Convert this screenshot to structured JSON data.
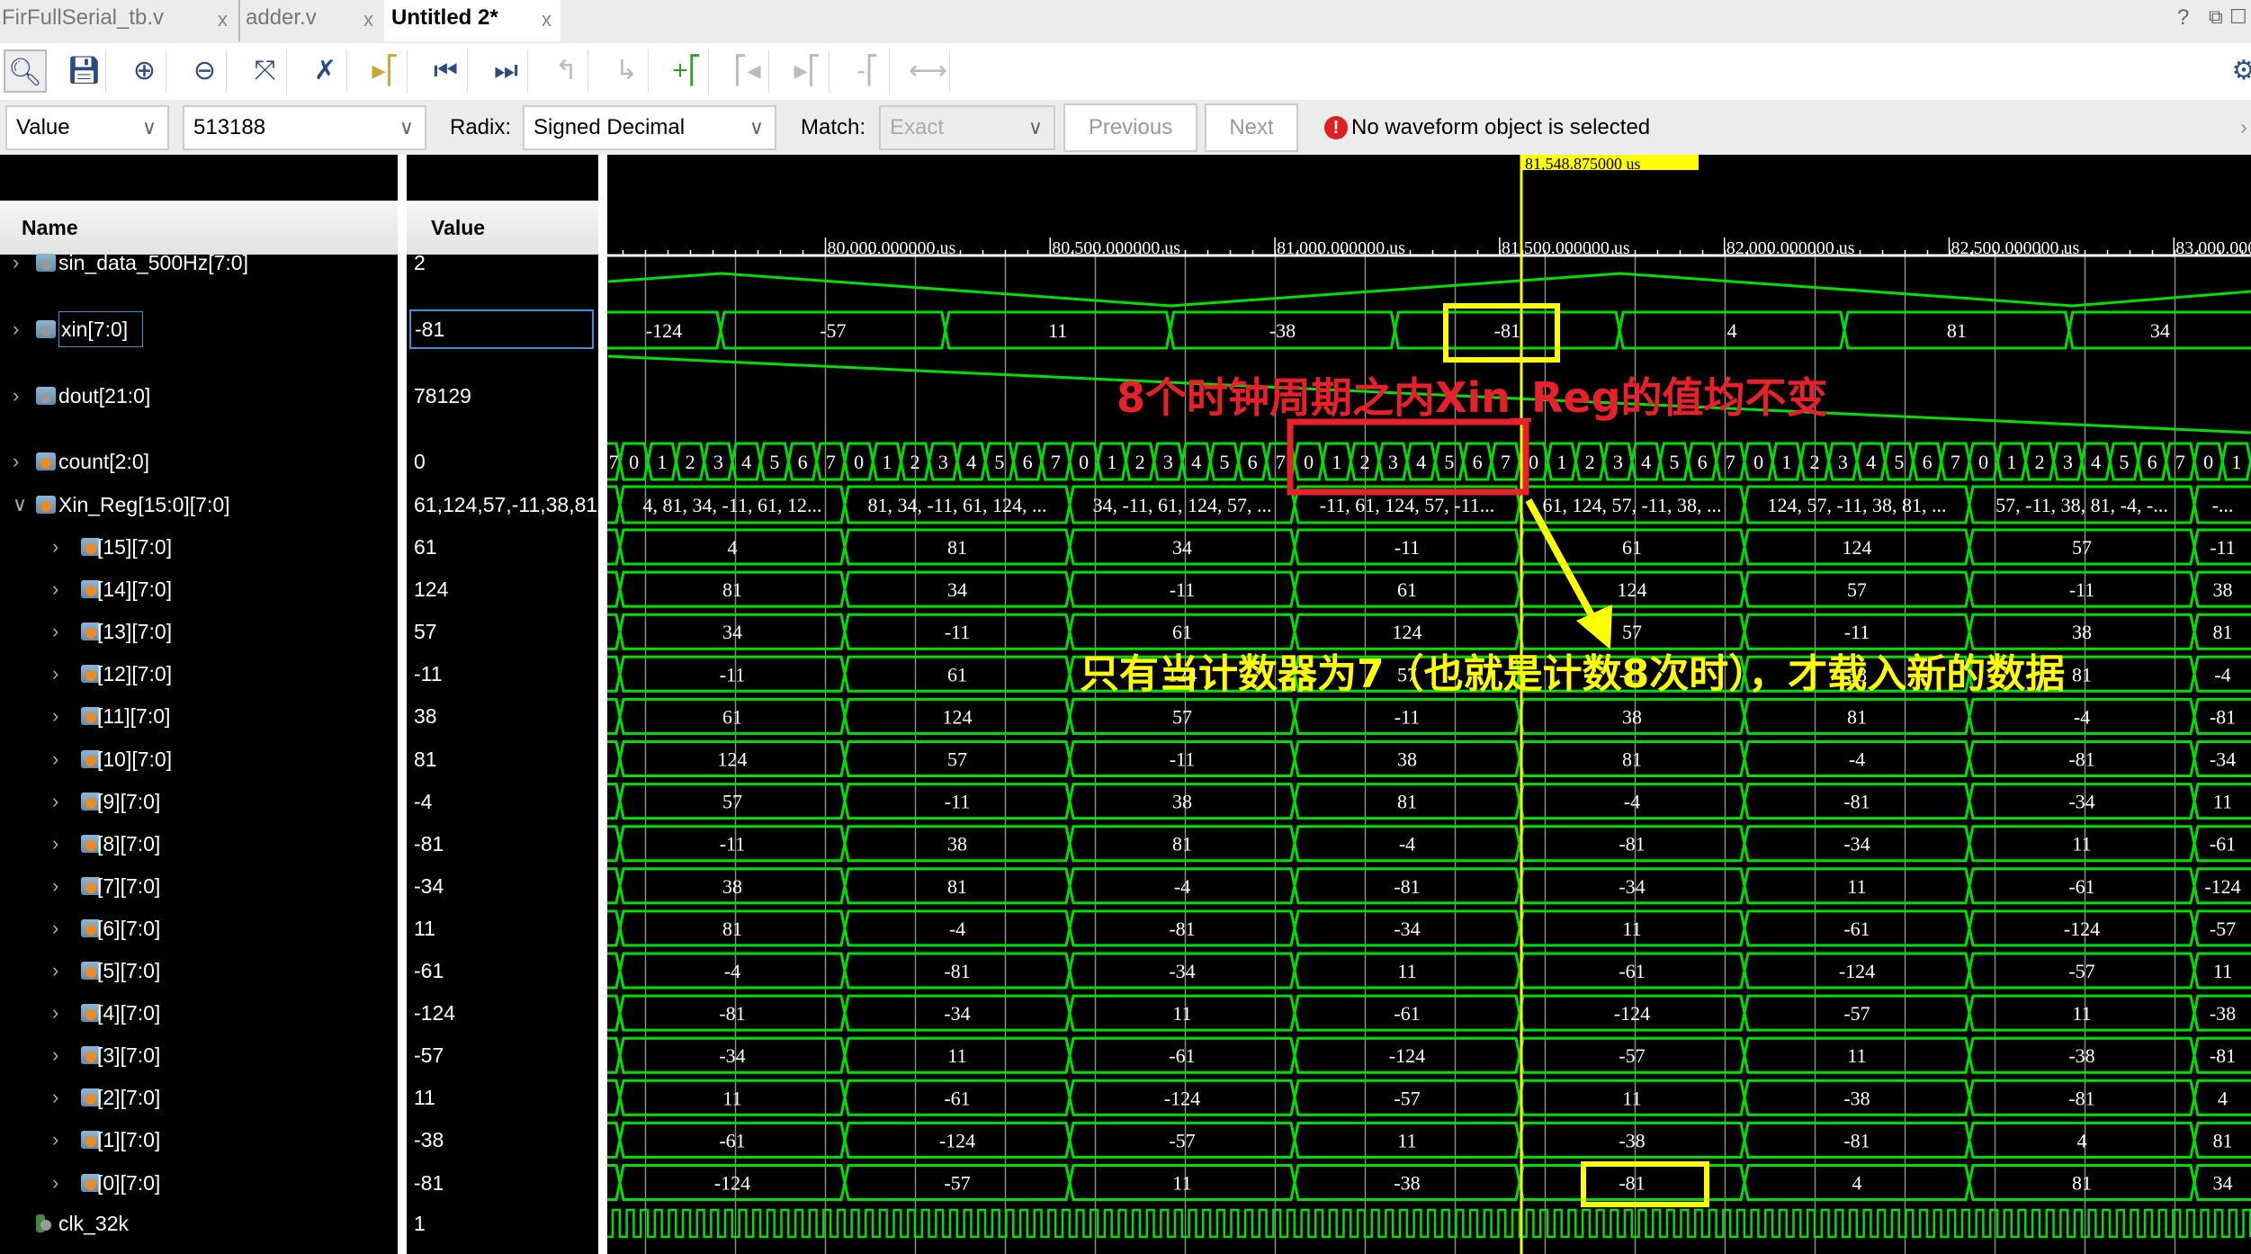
{
  "tabs": [
    {
      "label": "FirFullSerial_tb.v",
      "close": "x"
    },
    {
      "label": "adder.v",
      "close": "x"
    },
    {
      "label": "Untitled 2*",
      "close": "x"
    }
  ],
  "window_controls": [
    "?",
    "⧉",
    "☐"
  ],
  "toolbar": {
    "icons": [
      "search-icon",
      "save-icon",
      "zoom-in-icon",
      "zoom-out-icon",
      "zoom-fit-icon",
      "cursor-snap-icon",
      "go-to-cursor-icon",
      "go-to-start-icon",
      "go-to-end-icon",
      "previous-transition-icon",
      "next-transition-icon",
      "add-marker-icon",
      "previous-marker-icon",
      "next-marker-icon",
      "remove-marker-icon",
      "swap-cursors-icon"
    ],
    "settings_icon": "gear-icon"
  },
  "search": {
    "type": "Value",
    "value": "513188",
    "radix_label": "Radix:",
    "radix": "Signed Decimal",
    "match_label": "Match:",
    "match": "Exact",
    "previous": "Previous",
    "next": "Next",
    "status": "No waveform object is selected"
  },
  "columns": {
    "name": "Name",
    "value": "Value"
  },
  "signals": [
    {
      "name": "sin_data_500Hz[7:0]",
      "value": "2",
      "icon": "analog"
    },
    {
      "name": "xin[7:0]",
      "value": "-81",
      "icon": "analog"
    },
    {
      "name": "dout[21:0]",
      "value": "78129",
      "icon": "analog"
    },
    {
      "name": "count[2:0]",
      "value": "0",
      "icon": "reg"
    },
    {
      "name": "Xin_Reg[15:0][7:0]",
      "value": "61,124,57,-11,38,81",
      "icon": "reg"
    },
    {
      "name": "[15][7:0]",
      "value": "61"
    },
    {
      "name": "[14][7:0]",
      "value": "124"
    },
    {
      "name": "[13][7:0]",
      "value": "57"
    },
    {
      "name": "[12][7:0]",
      "value": "-11"
    },
    {
      "name": "[11][7:0]",
      "value": "38"
    },
    {
      "name": "[10][7:0]",
      "value": "81"
    },
    {
      "name": "[9][7:0]",
      "value": "-4"
    },
    {
      "name": "[8][7:0]",
      "value": "-81"
    },
    {
      "name": "[7][7:0]",
      "value": "-34"
    },
    {
      "name": "[6][7:0]",
      "value": "11"
    },
    {
      "name": "[5][7:0]",
      "value": "-61"
    },
    {
      "name": "[4][7:0]",
      "value": "-124"
    },
    {
      "name": "[3][7:0]",
      "value": "-57"
    },
    {
      "name": "[2][7:0]",
      "value": "11"
    },
    {
      "name": "[1][7:0]",
      "value": "-38"
    },
    {
      "name": "[0][7:0]",
      "value": "-81"
    },
    {
      "name": "clk_32k",
      "value": "1",
      "icon": "clock"
    }
  ],
  "waveform": {
    "cursor_label": "81,548.875000 us",
    "time_ticks": [
      "80,000.000000 us",
      "80,500.000000 us",
      "81,000.000000 us",
      "81,500.000000 us",
      "82,000.000000 us",
      "82,500.000000 us",
      "83,000.000000 us"
    ],
    "wave_color": "#00e000",
    "cursor_color": "#ffff00",
    "xin": [
      "-124",
      "-57",
      "11",
      "-38",
      "-81",
      "4",
      "81",
      "34"
    ],
    "count": [
      "7",
      "0",
      "1",
      "2",
      "3",
      "4",
      "5",
      "6",
      "7",
      "0",
      "1",
      "2",
      "3",
      "4",
      "5",
      "6",
      "7",
      "0",
      "1",
      "2",
      "3",
      "4",
      "5",
      "6",
      "7",
      "0",
      "1",
      "2",
      "3",
      "4",
      "5",
      "6",
      "7",
      "0",
      "1",
      "2",
      "3",
      "4",
      "5",
      "6",
      "7",
      "0",
      "1",
      "2",
      "3",
      "4",
      "5",
      "6",
      "7",
      "0",
      "1",
      "2",
      "3",
      "4",
      "5",
      "6",
      "7",
      "0",
      "1"
    ],
    "xin_reg": [
      "4, 81, 34, -11, 61, 12...",
      "81, 34, -11, 61, 124, ...",
      "34, -11, 61, 124, 57, ...",
      "-11, 61, 124, 57, -11...",
      "61, 124, 57, -11, 38, ...",
      "124, 57, -11, 38, 81, ...",
      "57, -11, 38, 81, -4, -...",
      "-..."
    ],
    "regs": [
      [
        "4",
        "81",
        "34",
        "-11",
        "61",
        "124",
        "57",
        "-11"
      ],
      [
        "81",
        "34",
        "-11",
        "61",
        "124",
        "57",
        "-11",
        "38"
      ],
      [
        "34",
        "-11",
        "61",
        "124",
        "57",
        "-11",
        "38",
        "81"
      ],
      [
        "-11",
        "61",
        "124",
        "57",
        "-11",
        "38",
        "81",
        "-4"
      ],
      [
        "61",
        "124",
        "57",
        "-11",
        "38",
        "81",
        "-4",
        "-81"
      ],
      [
        "124",
        "57",
        "-11",
        "38",
        "81",
        "-4",
        "-81",
        "-34"
      ],
      [
        "57",
        "-11",
        "38",
        "81",
        "-4",
        "-81",
        "-34",
        "11"
      ],
      [
        "-11",
        "38",
        "81",
        "-4",
        "-81",
        "-34",
        "11",
        "-61"
      ],
      [
        "38",
        "81",
        "-4",
        "-81",
        "-34",
        "11",
        "-61",
        "-124"
      ],
      [
        "81",
        "-4",
        "-81",
        "-34",
        "11",
        "-61",
        "-124",
        "-57"
      ],
      [
        "-4",
        "-81",
        "-34",
        "11",
        "-61",
        "-124",
        "-57",
        "11"
      ],
      [
        "-81",
        "-34",
        "11",
        "-61",
        "-124",
        "-57",
        "11",
        "-38"
      ],
      [
        "-34",
        "11",
        "-61",
        "-124",
        "-57",
        "11",
        "-38",
        "-81"
      ],
      [
        "11",
        "-61",
        "-124",
        "-57",
        "11",
        "-38",
        "-81",
        "4"
      ],
      [
        "-61",
        "-124",
        "-57",
        "11",
        "-38",
        "-81",
        "4",
        "81"
      ],
      [
        "-124",
        "-57",
        "11",
        "-38",
        "-81",
        "4",
        "81",
        "34"
      ]
    ]
  },
  "annotations": {
    "red_note": "8个时钟周期之内Xin_Reg的值均不变",
    "yellow_note": "只有当计数器为7（也就是计数8次时），才载入新的数据",
    "red_color": "#e8202a",
    "yellow_color": "#ffff00"
  }
}
